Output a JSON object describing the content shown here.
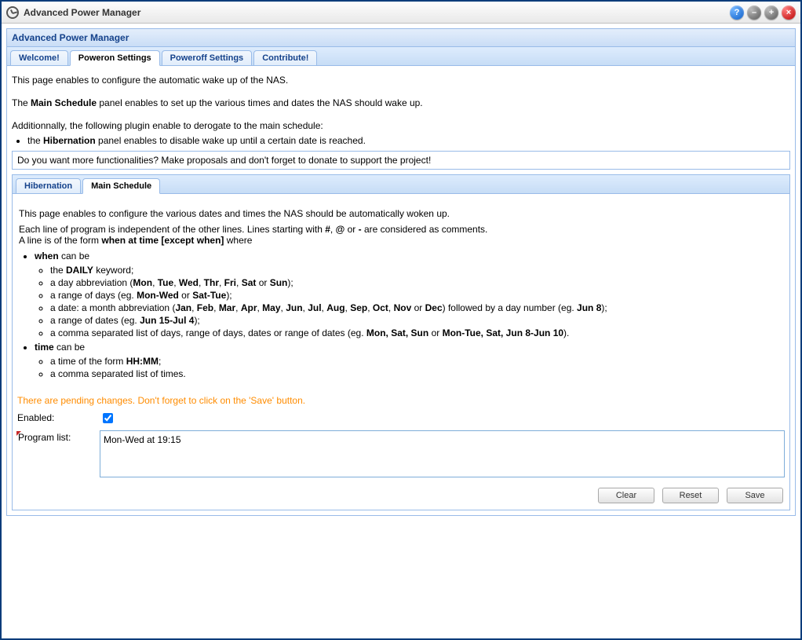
{
  "window": {
    "title": "Advanced Power Manager"
  },
  "panel": {
    "title": "Advanced Power Manager"
  },
  "tabs": {
    "main": [
      {
        "label": "Welcome!"
      },
      {
        "label": "Poweron Settings"
      },
      {
        "label": "Poweroff Settings"
      },
      {
        "label": "Contribute!"
      }
    ],
    "sub": [
      {
        "label": "Hibernation"
      },
      {
        "label": "Main Schedule"
      }
    ]
  },
  "intro": {
    "line1a": "This page enables to configure the automatic wake up of the NAS.",
    "line2a": "The ",
    "line2b": "Main Schedule",
    "line2c": " panel enables to set up the various times and dates the NAS should wake up.",
    "line3": "Additionnally, the following plugin enable to derogate to the main schedule:",
    "hib_a": "the ",
    "hib_b": "Hibernation",
    "hib_c": " panel enables to disable wake up until a certain date is reached."
  },
  "banner": "Do you want more functionalities? Make proposals and don't forget to donate to support the project!",
  "schedule_help": {
    "p1": "This page enables to configure the various dates and times the NAS should be automatically woken up.",
    "p2a": "Each line of program is independent of the other lines. Lines starting with ",
    "p2b": "#",
    "p2c": ", ",
    "p2d": "@",
    "p2e": " or ",
    "p2f": "-",
    "p2g": " are considered as comments.",
    "p3a": "A line is of the form ",
    "p3b": "when at time [except when]",
    "p3c": " where",
    "when_label": "when",
    "when_canbe": " can be",
    "daily_a": "the ",
    "daily_b": "DAILY",
    "daily_c": " keyword;",
    "dayabbr_a": "a day abbreviation (",
    "days": [
      "Mon",
      "Tue",
      "Wed",
      "Thr",
      "Fri",
      "Sat",
      "Sun"
    ],
    "or": " or ",
    "dayabbr_c": ");",
    "rangedays_a": "a range of days (eg. ",
    "rangedays_b": "Mon-Wed",
    "rangedays_c": " or ",
    "rangedays_d": "Sat-Tue",
    "rangedays_e": ");",
    "date_a": "a date: a month abbreviation (",
    "months": [
      "Jan",
      "Feb",
      "Mar",
      "Apr",
      "May",
      "Jun",
      "Jul",
      "Aug",
      "Sep",
      "Oct",
      "Nov",
      "Dec"
    ],
    "date_c": ") followed by a day number (eg. ",
    "date_d": "Jun 8",
    "date_e": ");",
    "rangedates_a": "a range of dates (eg. ",
    "rangedates_b": "Jun 15-Jul 4",
    "rangedates_c": ");",
    "csv_a": "a comma separated list of days, range of days, dates or range of dates (eg. ",
    "csv_b": "Mon, Sat, Sun",
    "csv_c": " or ",
    "csv_d": "Mon-Tue, Sat, Jun 8-Jun 10",
    "csv_e": ").",
    "time_label": "time",
    "time_canbe": " can be",
    "timeform_a": "a time of the form ",
    "timeform_b": "HH:MM",
    "timeform_c": ";",
    "timecsv": "a comma separated list of times."
  },
  "warning": "There are pending changes. Don't forget to click on the 'Save' button.",
  "form": {
    "enabled_label": "Enabled:",
    "enabled_value": true,
    "program_label": "Program list:",
    "program_value": "Mon-Wed at 19:15"
  },
  "buttons": {
    "clear": "Clear",
    "reset": "Reset",
    "save": "Save"
  }
}
